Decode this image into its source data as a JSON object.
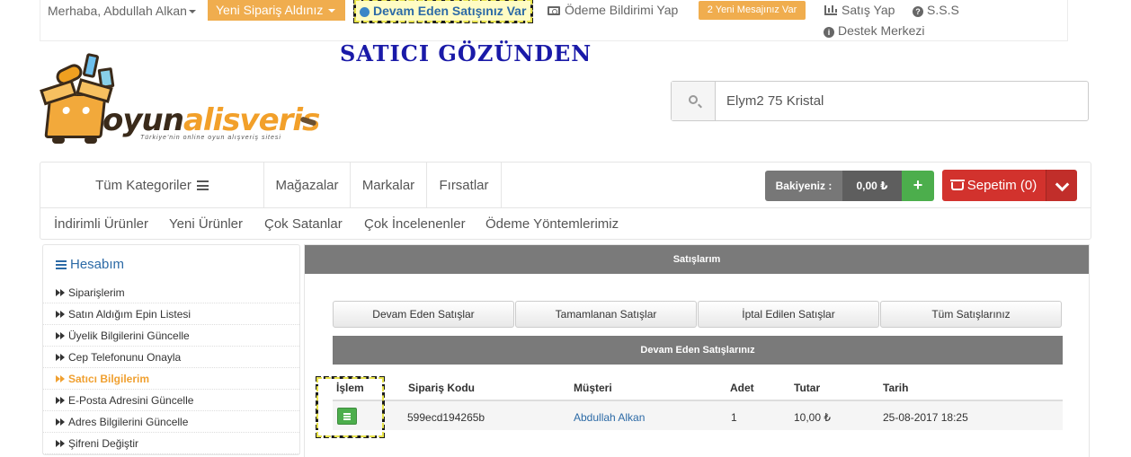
{
  "topbar": {
    "greeting": "Merhaba, Abdullah Alkan",
    "new_order": "Yeni Sipariş Aldınız",
    "ongoing_sale": "Devam Eden Satışınız Var",
    "payment_notice": "Ödeme Bildirimi Yap",
    "messages": "2 Yeni Mesajınız Var",
    "sell": "Satış Yap",
    "faq": "S.S.S",
    "support": "Destek Merkezi"
  },
  "annotation": "SATICI GÖZÜNDEN",
  "logo": {
    "brand_part1": "oyun",
    "brand_part2": "alisveris",
    "tagline": "Türkiye'nin online oyun alışveriş sitesi"
  },
  "search": {
    "value": "Elym2 75 Kristal"
  },
  "nav": {
    "all_categories": "Tüm Kategoriler",
    "links": [
      "Mağazalar",
      "Markalar",
      "Fırsatlar"
    ],
    "balance_label": "Bakiyeniz :",
    "balance_amount": "0,00 ₺",
    "add_balance": "+",
    "cart": "Sepetim (0)",
    "sub_links": [
      "İndirimli Ürünler",
      "Yeni Ürünler",
      "Çok Satanlar",
      "Çok İncelenenler",
      "Ödeme Yöntemlerimiz"
    ]
  },
  "sidebar": {
    "title": "Hesabım",
    "items": [
      "Siparişlerim",
      "Satın Aldığım Epin Listesi",
      "Üyelik Bilgilerini Güncelle",
      "Cep Telefonunu Onayla",
      "Satıcı Bilgilerim",
      "E-Posta Adresini Güncelle",
      "Adres Bilgilerini Güncelle",
      "Şifreni Değiştir"
    ],
    "active_index": 4
  },
  "main": {
    "title": "Satışlarım",
    "tabs": [
      "Devam Eden Satışlar",
      "Tamamlanan Satışlar",
      "İptal Edilen Satışlar",
      "Tüm Satışlarınız"
    ],
    "section_title": "Devam Eden Satışlarınız",
    "columns": [
      "İşlem",
      "Sipariş Kodu",
      "Müşteri",
      "Adet",
      "Tutar",
      "Tarih"
    ],
    "rows": [
      {
        "order_code": "599ecd194265b",
        "customer": "Abdullah Alkan",
        "quantity": "1",
        "amount": "10,00 ₺",
        "date": "25-08-2017 18:25"
      }
    ]
  },
  "colors": {
    "accent_orange": "#f0ad4e",
    "link_blue": "#2c6aa6",
    "cart_red": "#d2322d",
    "success_green": "#4cae4c",
    "annotation_blue": "#1a1aa8",
    "highlight_yellow": "#e8e34a"
  }
}
